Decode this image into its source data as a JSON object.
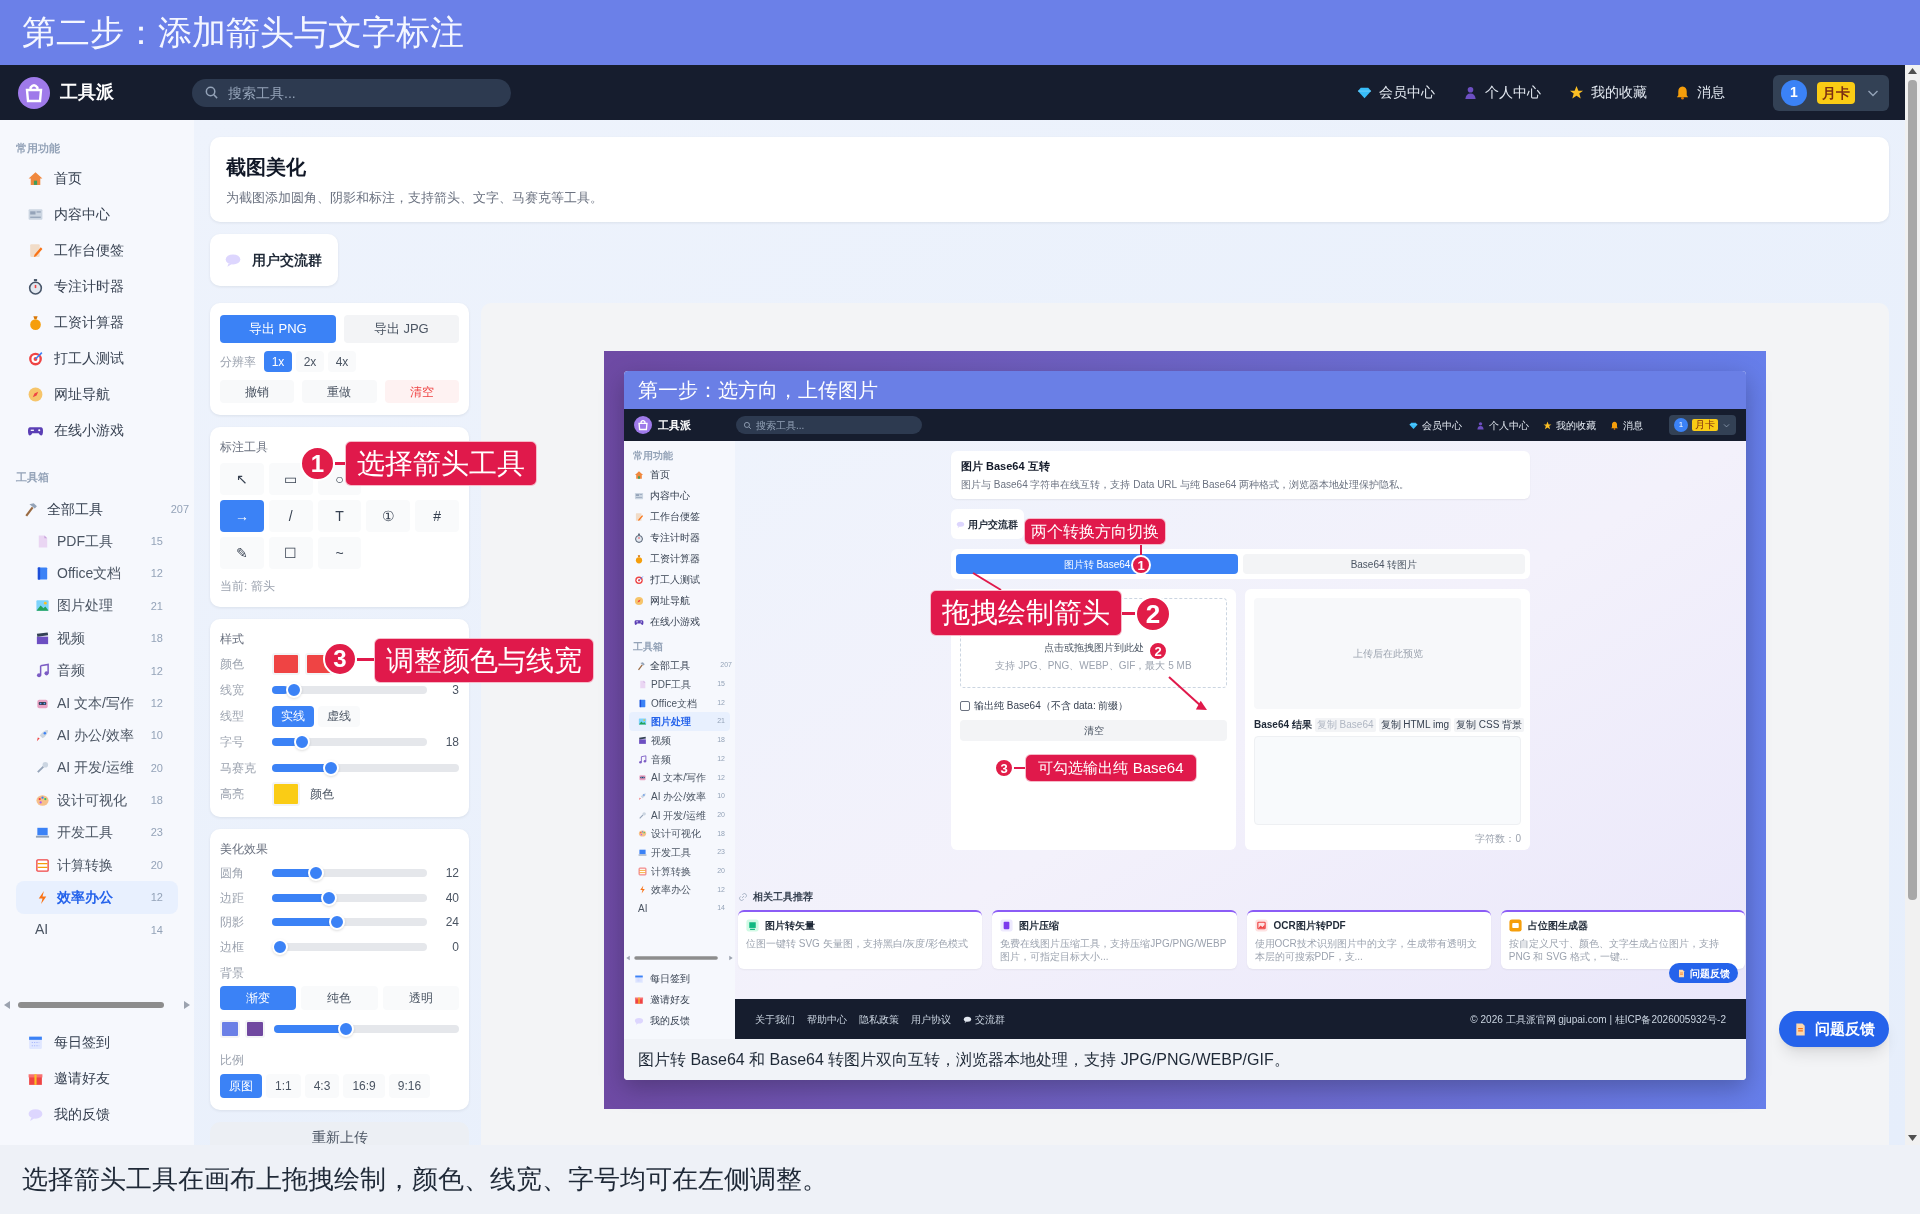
{
  "banner": {
    "title": "第二步：添加箭头与文字标注"
  },
  "navbar": {
    "brand": "工具派",
    "search": {
      "placeholder": "搜索工具..."
    },
    "links": [
      {
        "label": "会员中心"
      },
      {
        "label": "个人中心"
      },
      {
        "label": "我的收藏"
      },
      {
        "label": "消息"
      }
    ],
    "user": {
      "avatar": "1",
      "badge": "月卡"
    }
  },
  "sidebar": {
    "common": {
      "title": "常用功能",
      "items": [
        {
          "label": "首页",
          "selected": false
        },
        {
          "label": "内容中心",
          "selected": false
        },
        {
          "label": "工作台便签",
          "selected": false
        },
        {
          "label": "专注计时器",
          "selected": false
        },
        {
          "label": "工资计算器",
          "selected": false
        },
        {
          "label": "打工人测试",
          "selected": false
        },
        {
          "label": "网址导航",
          "selected": false
        },
        {
          "label": "在线小游戏",
          "selected": false
        }
      ]
    },
    "toolbox": {
      "title": "工具箱",
      "items": [
        {
          "label": "全部工具",
          "count": "207",
          "selected": false,
          "children": [
            {
              "label": "PDF工具",
              "count": "15",
              "selected": false
            },
            {
              "label": "Office文档",
              "count": "12",
              "selected": false
            },
            {
              "label": "图片处理",
              "count": "21",
              "selected": false
            },
            {
              "label": "视频",
              "count": "18",
              "selected": false
            },
            {
              "label": "音频",
              "count": "12",
              "selected": false
            },
            {
              "label": "AI 文本/写作",
              "count": "12",
              "selected": false
            },
            {
              "label": "AI 办公/效率",
              "count": "10",
              "selected": false
            },
            {
              "label": "AI 开发/运维",
              "count": "20",
              "selected": false
            },
            {
              "label": "设计可视化",
              "count": "18",
              "selected": false
            },
            {
              "label": "开发工具",
              "count": "23",
              "selected": false
            },
            {
              "label": "计算转换",
              "count": "20",
              "selected": false
            },
            {
              "label": "效率办公",
              "count": "12",
              "selected": true
            },
            {
              "label": "AI",
              "count": "14",
              "selected": false
            }
          ]
        }
      ]
    },
    "bottom_items": [
      {
        "label": "每日签到",
        "selected": false
      },
      {
        "label": "邀请好友",
        "selected": false
      },
      {
        "label": "我的反馈",
        "selected": false
      }
    ]
  },
  "page_header": {
    "title": "截图美化",
    "subtitle": "为截图添加圆角、阴影和标注，支持箭头、文字、马赛克等工具。"
  },
  "community_button": "用户交流群",
  "export_panel": {
    "formats": [
      {
        "label": "导出 PNG",
        "selected": true
      },
      {
        "label": "导出 JPG",
        "selected": false
      }
    ],
    "resolution": {
      "label": "分辨率",
      "options": [
        {
          "label": "1x",
          "selected": true
        },
        {
          "label": "2x",
          "selected": false
        },
        {
          "label": "4x",
          "selected": false
        }
      ]
    },
    "actions": [
      {
        "label": "撤销",
        "kind": "plain"
      },
      {
        "label": "重做",
        "kind": "plain"
      },
      {
        "label": "清空",
        "kind": "danger"
      }
    ]
  },
  "annotation_tools": {
    "title": "标注工具",
    "rows": [
      [
        {
          "symbol": "↖",
          "selected": false
        },
        {
          "symbol": "▭",
          "selected": false
        },
        {
          "symbol": "○",
          "selected": false
        }
      ],
      [
        {
          "symbol": "→",
          "selected": true
        },
        {
          "symbol": "/",
          "selected": false
        },
        {
          "symbol": "T",
          "selected": false
        },
        {
          "symbol": "①",
          "selected": false
        },
        {
          "symbol": "#",
          "selected": false
        }
      ],
      [
        {
          "symbol": "✎",
          "selected": false
        },
        {
          "symbol": "☐",
          "selected": false
        },
        {
          "symbol": "~",
          "selected": false
        }
      ]
    ],
    "current": "当前: 箭头"
  },
  "style_panel": {
    "title": "样式",
    "rows": [
      {
        "kind": "swatches",
        "label": "颜色",
        "swatches": [
          {
            "color": "#ef4444"
          },
          {
            "color": "#ef4444"
          }
        ]
      },
      {
        "kind": "slider",
        "label": "线宽",
        "level": 0.1,
        "value": "3"
      },
      {
        "kind": "toggle",
        "label": "线型",
        "options": [
          {
            "label": "实线",
            "selected": true
          },
          {
            "label": "虚线",
            "selected": false
          }
        ]
      },
      {
        "kind": "slider",
        "label": "字号",
        "level": 0.16,
        "value": "18"
      },
      {
        "kind": "slider",
        "label": "马赛克",
        "level": 0.3
      },
      {
        "kind": "swatch_label",
        "label": "高亮",
        "color": "#facc15",
        "text": "颜色"
      }
    ]
  },
  "effects_panel": {
    "title": "美化效果",
    "sliders": [
      {
        "label": "圆角",
        "level": 0.26,
        "value": "12"
      },
      {
        "label": "边距",
        "level": 0.35,
        "value": "40"
      },
      {
        "label": "阴影",
        "level": 0.41,
        "value": "24"
      },
      {
        "label": "边框",
        "level": 0,
        "value": "0"
      }
    ],
    "background": {
      "label": "背景",
      "options": [
        {
          "label": "渐变",
          "selected": true
        },
        {
          "label": "纯色",
          "selected": false
        },
        {
          "label": "透明",
          "selected": false
        }
      ],
      "colors": [
        {
          "color": "#6a7fe6"
        },
        {
          "color": "#7048a0"
        }
      ],
      "level": 0.38
    },
    "ratio": {
      "label": "比例",
      "options": [
        {
          "label": "原图",
          "selected": true
        },
        {
          "label": "1:1",
          "selected": false
        },
        {
          "label": "4:3",
          "selected": false
        },
        {
          "label": "16:9",
          "selected": false
        },
        {
          "label": "9:16",
          "selected": false
        }
      ]
    }
  },
  "reupload_button": "重新上传",
  "canvas": {
    "screenshot": {
      "banner": "第一步：选方向，上传图片",
      "navbar": {
        "brand": "工具派",
        "search": {
          "placeholder": "搜索工具..."
        },
        "links": [
          {
            "label": "会员中心"
          },
          {
            "label": "个人中心"
          },
          {
            "label": "我的收藏"
          },
          {
            "label": "消息"
          }
        ],
        "user": {
          "avatar": "1",
          "badge": "月卡"
        }
      },
      "sidebar": {
        "common": {
          "title": "常用功能",
          "items": [
            {
              "label": "首页",
              "selected": false
            },
            {
              "label": "内容中心",
              "selected": false
            },
            {
              "label": "工作台便签",
              "selected": false
            },
            {
              "label": "专注计时器",
              "selected": false
            },
            {
              "label": "工资计算器",
              "selected": false
            },
            {
              "label": "打工人测试",
              "selected": false
            },
            {
              "label": "网址导航",
              "selected": false
            },
            {
              "label": "在线小游戏",
              "selected": false
            }
          ]
        },
        "toolbox": {
          "title": "工具箱",
          "items": [
            {
              "label": "全部工具",
              "count": "207",
              "selected": false,
              "children": [
                {
                  "label": "PDF工具",
                  "count": "15",
                  "selected": false
                },
                {
                  "label": "Office文档",
                  "count": "12",
                  "selected": false
                },
                {
                  "label": "图片处理",
                  "count": "21",
                  "selected": true
                },
                {
                  "label": "视频",
                  "count": "18",
                  "selected": false
                },
                {
                  "label": "音频",
                  "count": "12",
                  "selected": false
                },
                {
                  "label": "AI 文本/写作",
                  "count": "12",
                  "selected": false
                },
                {
                  "label": "AI 办公/效率",
                  "count": "10",
                  "selected": false
                },
                {
                  "label": "AI 开发/运维",
                  "count": "20",
                  "selected": false
                },
                {
                  "label": "设计可视化",
                  "count": "18",
                  "selected": false
                },
                {
                  "label": "开发工具",
                  "count": "23",
                  "selected": false
                },
                {
                  "label": "计算转换",
                  "count": "20",
                  "selected": false
                },
                {
                  "label": "效率办公",
                  "count": "12",
                  "selected": false
                },
                {
                  "label": "AI",
                  "count": "14",
                  "selected": false
                }
              ]
            }
          ]
        },
        "bottom_items": [
          {
            "label": "每日签到",
            "selected": false
          },
          {
            "label": "邀请好友",
            "selected": false
          },
          {
            "label": "我的反馈",
            "selected": false
          }
        ]
      },
      "header": {
        "title": "图片 Base64 互转",
        "subtitle": "图片与 Base64 字符串在线互转，支持 Data URL 与纯 Base64 两种格式，浏览器本地处理保护隐私。"
      },
      "community_button": "用户交流群",
      "tabs": [
        {
          "label": "图片转 Base64",
          "selected": true
        },
        {
          "label": "Base64 转图片",
          "selected": false
        }
      ],
      "upload": {
        "hint": "点击或拖拽图片到此处",
        "formats": "支持 JPG、PNG、WEBP、GIF，最大 5 MB",
        "checkbox": {
          "label": "输出纯 Base64（不含 data: 前缀）",
          "checked": false
        },
        "clear_button": "清空"
      },
      "preview": {
        "placeholder": "上传后在此预览",
        "result_title": "Base64 结果",
        "copy_buttons": [
          {
            "label": "复制 Base64",
            "disabled": true
          },
          {
            "label": "复制 HTML img",
            "disabled": false
          },
          {
            "label": "复制 CSS 背景",
            "disabled": false
          }
        ],
        "char_count": "字符数：0"
      },
      "related": {
        "title": "相关工具推荐",
        "cards": [
          {
            "title": "图片转矢量",
            "desc": "位图一键转 SVG 矢量图，支持黑白/灰度/彩色模式"
          },
          {
            "title": "图片压缩",
            "desc": "免费在线图片压缩工具，支持压缩JPG/PNG/WEBP图片，可指定目标大小..."
          },
          {
            "title": "OCR图片转PDF",
            "desc": "使用OCR技术识别图片中的文字，生成带有透明文本层的可搜索PDF，支..."
          },
          {
            "title": "占位图生成器",
            "desc": "按自定义尺寸、颜色、文字生成占位图片，支持 PNG 和 SVG 格式，一键..."
          }
        ]
      },
      "feedback_button": "问题反馈",
      "footer": {
        "links": [
          {
            "label": "关于我们"
          },
          {
            "label": "帮助中心"
          },
          {
            "label": "隐私政策"
          },
          {
            "label": "用户协议"
          },
          {
            "label": "交流群"
          }
        ],
        "copyright": "© 2026 工具派官网 gjupai.com | 桂ICP备2026005932号-2"
      },
      "caption": "图片转 Base64 和 Base64 转图片双向互转，浏览器本地处理，支持 JPG/PNG/WEBP/GIF。",
      "annotations": [
        {
          "number": "1",
          "text": "两个转换方向切换"
        },
        {
          "number": "2",
          "text": "拖拽绘制箭头"
        },
        {
          "number": "2"
        },
        {
          "number": "3",
          "text": "可勾选输出纯 Base64"
        }
      ]
    }
  },
  "annotations": [
    {
      "number": "1",
      "text": "选择箭头工具"
    },
    {
      "number": "3",
      "text": "调整颜色与线宽"
    }
  ],
  "feedback_button": "问题反馈",
  "caption": "选择箭头工具在画布上拖拽绘制，颜色、线宽、字号均可在左侧调整。"
}
